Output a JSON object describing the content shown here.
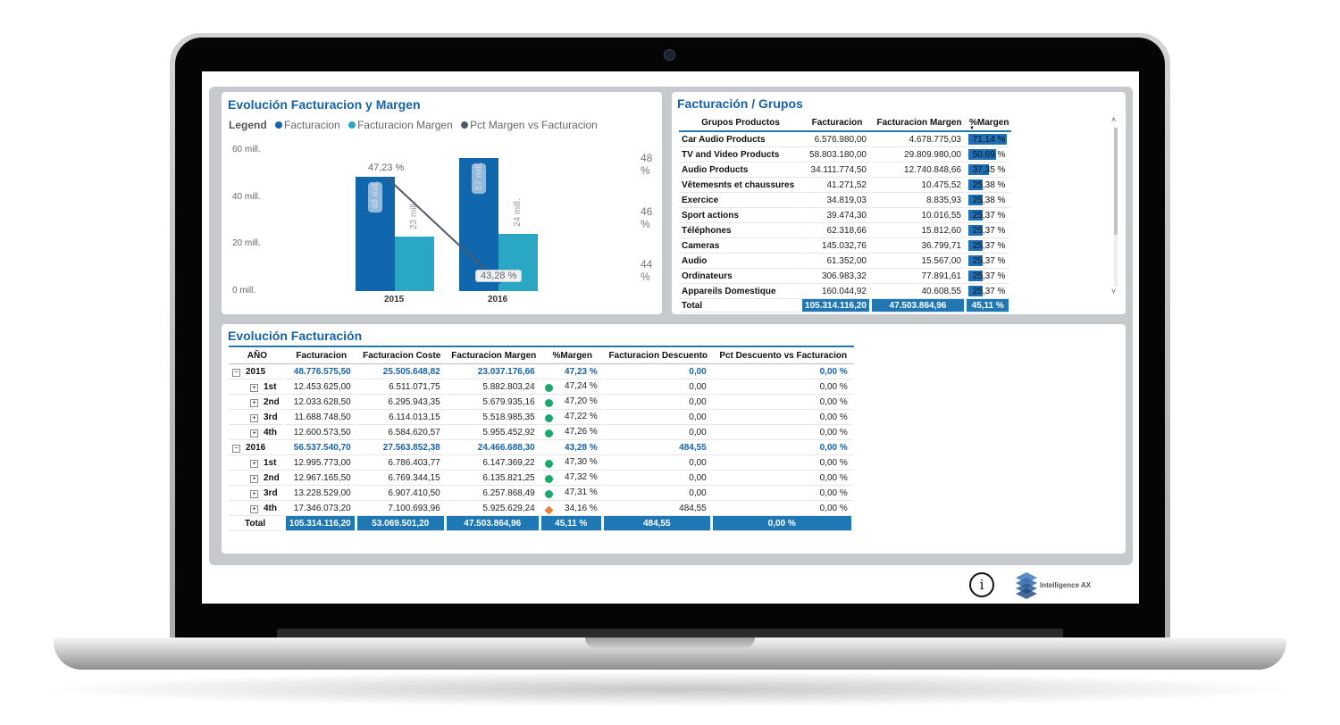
{
  "chart_panel": {
    "title": "Evolución Facturacion y Margen",
    "legend_label": "Legend",
    "legend": [
      {
        "name": "Facturacion",
        "color": "#1167ad"
      },
      {
        "name": "Facturacion Margen",
        "color": "#2aa7c4"
      },
      {
        "name": "Pct Margen vs Facturacion",
        "color": "#505a6b"
      }
    ]
  },
  "chart_data": {
    "type": "bar",
    "title": "Evolución Facturacion y Margen",
    "categories": [
      "2015",
      "2016"
    ],
    "series": [
      {
        "name": "Facturacion",
        "values": [
          48776575.5,
          56537540.7
        ],
        "bar_labels": [
          "48 mill.",
          "57 mill."
        ]
      },
      {
        "name": "Facturacion Margen",
        "values": [
          23037176.66,
          24466688.3
        ],
        "bar_labels": [
          "23 mill.",
          "24 mill."
        ]
      },
      {
        "name": "Pct Margen vs Facturacion",
        "type": "line",
        "axis": "secondary",
        "values": [
          47.23,
          43.28
        ],
        "labels": [
          "47,23 %",
          "43,28 %"
        ]
      }
    ],
    "y_ticks": [
      "0 mill.",
      "20 mill.",
      "40 mill.",
      "60 mill."
    ],
    "ylim": [
      0,
      60000000
    ],
    "y2_ticks": [
      "44 %",
      "46 %",
      "48 %"
    ],
    "y2lim": [
      43,
      48.3
    ],
    "grid": false,
    "legend_position": "top-left"
  },
  "groups_panel": {
    "title": "Facturación / Grupos",
    "columns": [
      "Grupos Productos",
      "Facturacion",
      "Facturacion Margen",
      "%Margen"
    ],
    "sort_indicator": "▼",
    "rows": [
      {
        "name": "Car Audio Products",
        "fact": "6.576.980,00",
        "margen": "4.678.775,03",
        "pct": "71,14 %",
        "value": 71.14
      },
      {
        "name": "TV and Video Products",
        "fact": "58.803.180,00",
        "margen": "29.809.980,00",
        "pct": "50,69 %",
        "value": 50.69
      },
      {
        "name": "Audio Products",
        "fact": "34.111.774,50",
        "margen": "12.740.848,66",
        "pct": "37,35 %",
        "value": 37.35
      },
      {
        "name": "Vêtemesnts et chaussures",
        "fact": "41.271,52",
        "margen": "10.475,52",
        "pct": "25,38 %",
        "value": 25.38
      },
      {
        "name": "Exercice",
        "fact": "34.819,03",
        "margen": "8.835,93",
        "pct": "25,38 %",
        "value": 25.38
      },
      {
        "name": "Sport actions",
        "fact": "39.474,30",
        "margen": "10.016,55",
        "pct": "25,37 %",
        "value": 25.37
      },
      {
        "name": "Téléphones",
        "fact": "62.318,66",
        "margen": "15.812,60",
        "pct": "25,37 %",
        "value": 25.37
      },
      {
        "name": "Cameras",
        "fact": "145.032,76",
        "margen": "36.799,71",
        "pct": "25,37 %",
        "value": 25.37
      },
      {
        "name": "Audio",
        "fact": "61.352,00",
        "margen": "15.567,00",
        "pct": "25,37 %",
        "value": 25.37
      },
      {
        "name": "Ordinateurs",
        "fact": "306.983,32",
        "margen": "77.891,61",
        "pct": "25,37 %",
        "value": 25.37
      },
      {
        "name": "Appareils Domestique",
        "fact": "160.044,92",
        "margen": "40.608,55",
        "pct": "25,37 %",
        "value": 25.37
      }
    ],
    "total": {
      "label": "Total",
      "fact": "105.314.116,20",
      "margen": "47.503.864,96",
      "pct": "45,11 %"
    },
    "scroll_up": "˄",
    "scroll_down": "˅"
  },
  "fact_panel": {
    "title": "Evolución Facturación",
    "columns": [
      "AÑO",
      "Facturacion",
      "Facturacion Coste",
      "Facturacion Margen",
      "%Margen",
      "Facturacion Descuento",
      "Pct Descuento vs Facturacion"
    ],
    "expand_collapsed": "+",
    "expand_open": "−",
    "rows": [
      {
        "label": "2015",
        "level": "year",
        "fact": "48.776.575,50",
        "coste": "25.505.648,82",
        "margen": "23.037.176,66",
        "pct": "47,23 %",
        "desc": "0,00",
        "pdesc": "0,00 %",
        "status": "none"
      },
      {
        "label": "1st",
        "level": "q",
        "fact": "12.453.625,00",
        "coste": "6.511.071,75",
        "margen": "5.882.803,24",
        "pct": "47,24 %",
        "desc": "0,00",
        "pdesc": "0,00 %",
        "status": "good"
      },
      {
        "label": "2nd",
        "level": "q",
        "fact": "12.033.628,50",
        "coste": "6.295.943,35",
        "margen": "5.679.935,16",
        "pct": "47,20 %",
        "desc": "0,00",
        "pdesc": "0,00 %",
        "status": "good"
      },
      {
        "label": "3rd",
        "level": "q",
        "fact": "11.688.748,50",
        "coste": "6.114.013,15",
        "margen": "5.518.985,35",
        "pct": "47,22 %",
        "desc": "0,00",
        "pdesc": "0,00 %",
        "status": "good"
      },
      {
        "label": "4th",
        "level": "q",
        "fact": "12.600.573,50",
        "coste": "6.584.620,57",
        "margen": "5.955.452,92",
        "pct": "47,26 %",
        "desc": "0,00",
        "pdesc": "0,00 %",
        "status": "good"
      },
      {
        "label": "2016",
        "level": "year",
        "fact": "56.537.540,70",
        "coste": "27.563.852,38",
        "margen": "24.466.688,30",
        "pct": "43,28 %",
        "desc": "484,55",
        "pdesc": "0,00 %",
        "status": "none"
      },
      {
        "label": "1st",
        "level": "q",
        "fact": "12.995.773,00",
        "coste": "6.786.403,77",
        "margen": "6.147.369,22",
        "pct": "47,30 %",
        "desc": "0,00",
        "pdesc": "0,00 %",
        "status": "good"
      },
      {
        "label": "2nd",
        "level": "q",
        "fact": "12.967.165,50",
        "coste": "6.769.344,15",
        "margen": "6.135.821,25",
        "pct": "47,32 %",
        "desc": "0,00",
        "pdesc": "0,00 %",
        "status": "good"
      },
      {
        "label": "3rd",
        "level": "q",
        "fact": "13.228.529,00",
        "coste": "6.907.410,50",
        "margen": "6.257.868,49",
        "pct": "47,31 %",
        "desc": "0,00",
        "pdesc": "0,00 %",
        "status": "good"
      },
      {
        "label": "4th",
        "level": "q",
        "fact": "17.346.073,20",
        "coste": "7.100.693,96",
        "margen": "5.925.629,24",
        "pct": "34,16 %",
        "desc": "484,55",
        "pdesc": "0,00 %",
        "status": "warn"
      }
    ],
    "total": {
      "label": "Total",
      "fact": "105.314.116,20",
      "coste": "53.069.501,20",
      "margen": "47.503.864,96",
      "pct": "45,11 %",
      "desc": "484,55",
      "pdesc": "0,00 %"
    }
  },
  "footer": {
    "info_icon": "i",
    "logo_text": "Intelligence AX",
    "colors": {
      "accent": "#1f78b4",
      "good": "#1aa86b",
      "warn": "#e8843c"
    }
  }
}
